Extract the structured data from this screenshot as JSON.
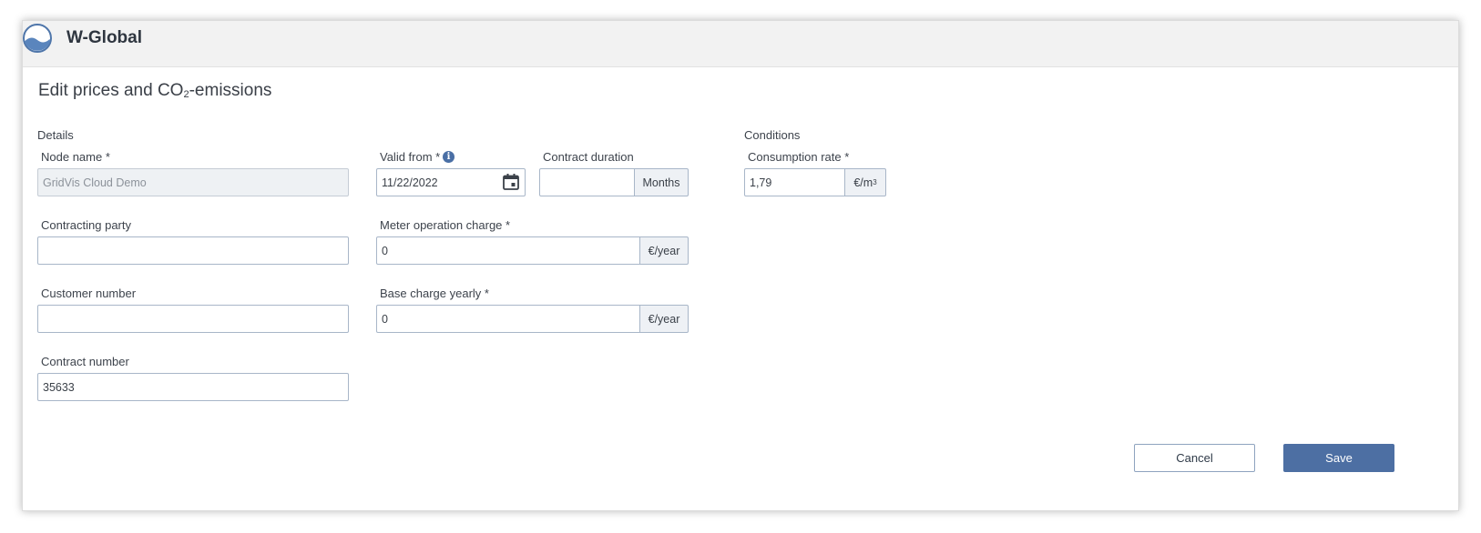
{
  "app": {
    "title": "W-Global",
    "logo_icon": "water-logo-icon",
    "accent": "#4d6fa3"
  },
  "page": {
    "title_prefix": "Edit prices and CO",
    "title_sub": "2",
    "title_suffix": "-emissions"
  },
  "details": {
    "section_label": "Details",
    "node_name": {
      "label": "Node name *",
      "value": "GridVis Cloud Demo",
      "disabled": true
    },
    "contracting_party": {
      "label": "Contracting party",
      "value": ""
    },
    "customer_number": {
      "label": "Customer number",
      "value": ""
    },
    "contract_number": {
      "label": "Contract number",
      "value": "35633"
    }
  },
  "pricing": {
    "valid_from": {
      "label": "Valid from *",
      "value": "11/22/2022",
      "info_icon": "info-icon",
      "calendar_icon": "calendar-icon"
    },
    "contract_duration": {
      "label": "Contract duration",
      "value": "",
      "unit": "Months"
    },
    "meter_operation_charge": {
      "label": "Meter operation charge *",
      "value": "0",
      "unit": "€/year"
    },
    "base_charge_yearly": {
      "label": "Base charge yearly *",
      "value": "0",
      "unit": "€/year"
    }
  },
  "conditions": {
    "section_label": "Conditions",
    "consumption_rate": {
      "label": "Consumption rate *",
      "value": "1,79",
      "unit_base": "€/m",
      "unit_sup": "3"
    }
  },
  "actions": {
    "cancel_label": "Cancel",
    "save_label": "Save"
  }
}
